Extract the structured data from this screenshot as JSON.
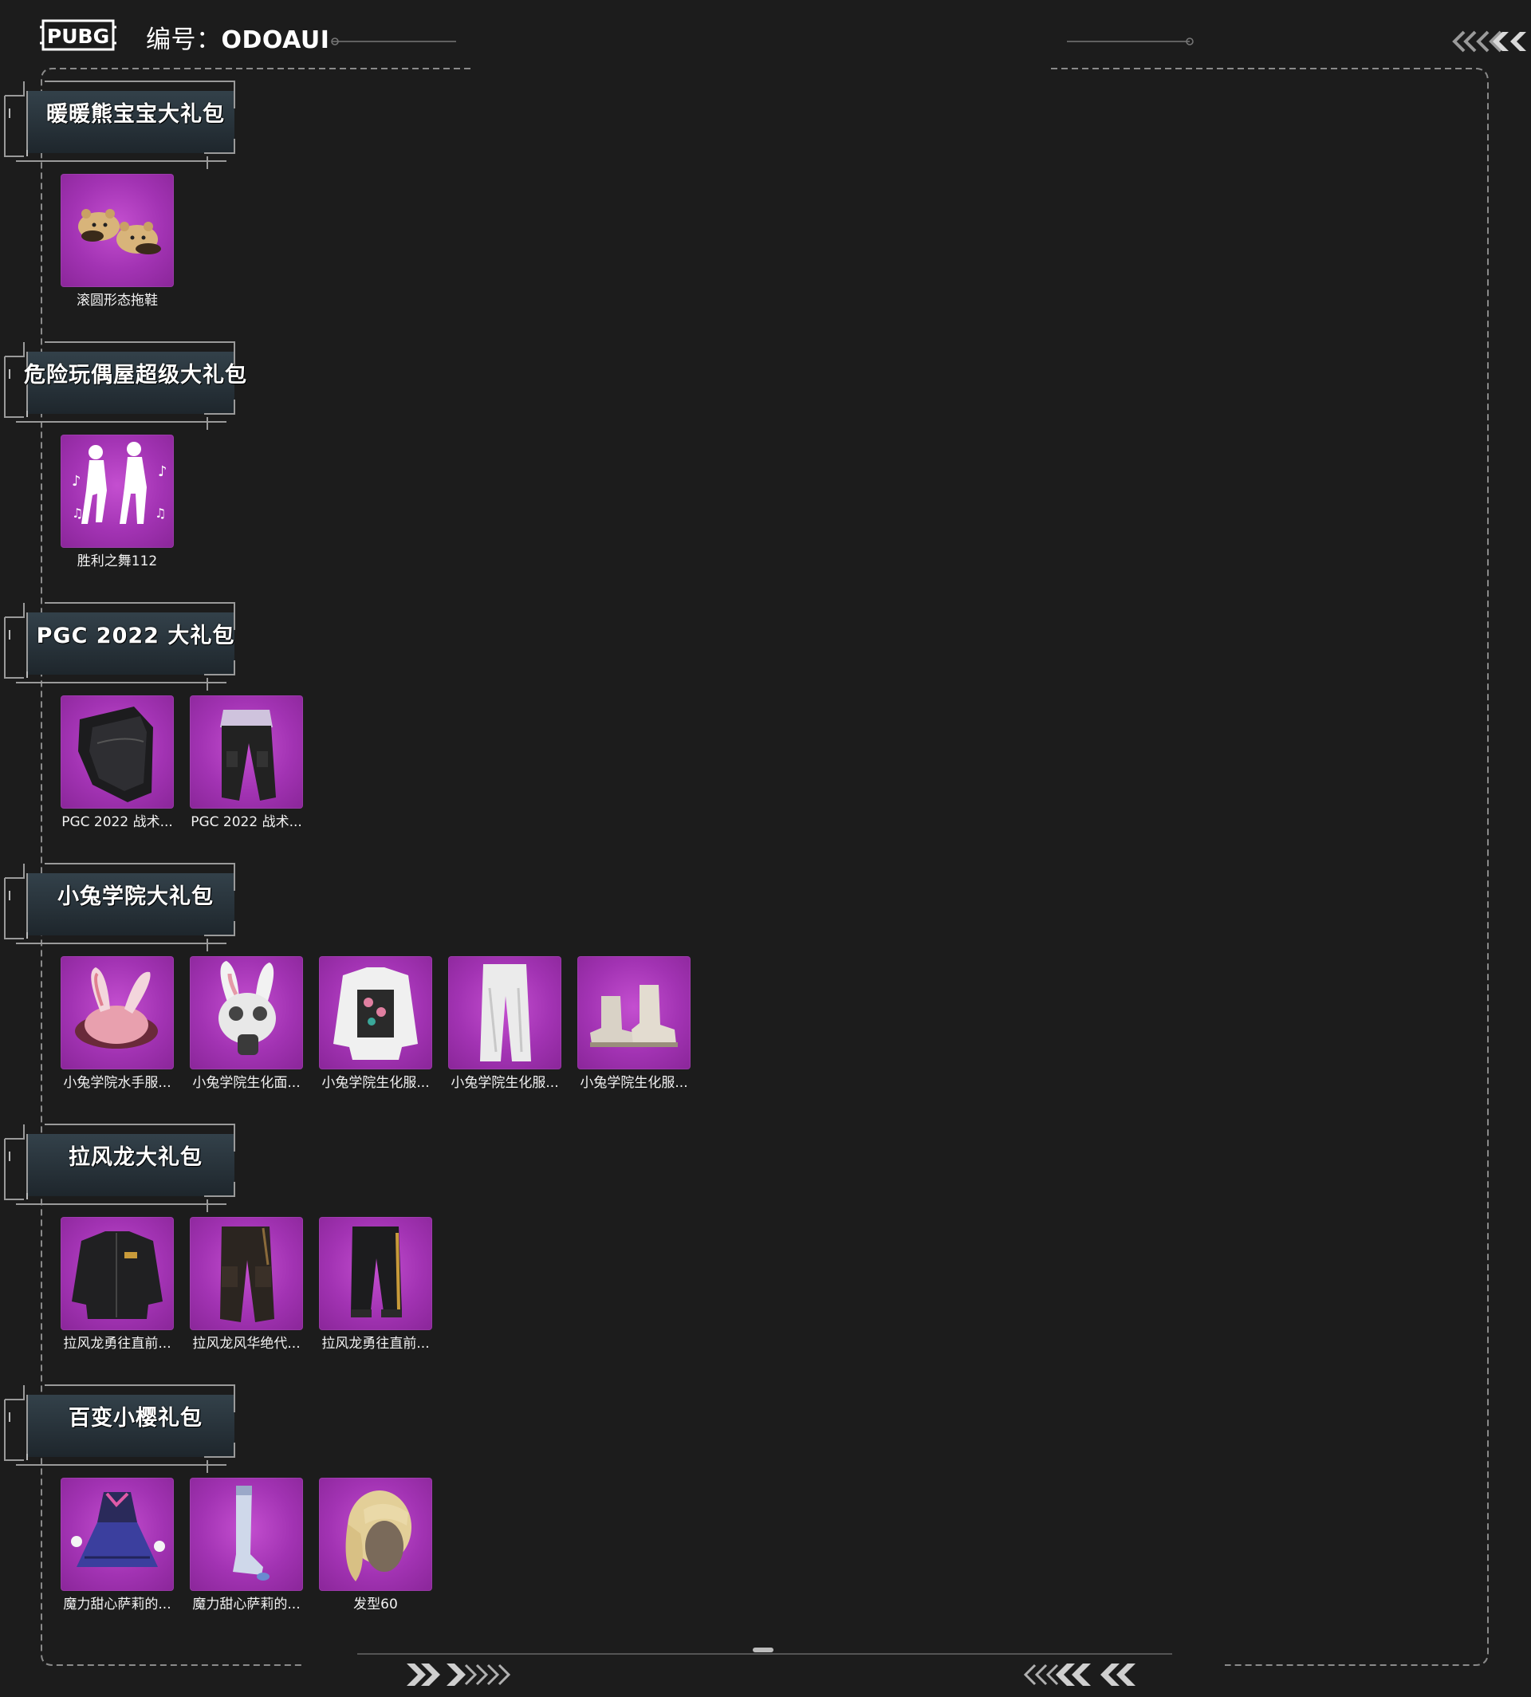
{
  "header": {
    "logo_text": "PUBG",
    "code_prefix": "编号：",
    "code_value": "ODOAUI"
  },
  "colors": {
    "background": "#1c1c1c",
    "item_tile": "#a233b3",
    "frame_line": "#8a8a8a"
  },
  "packs": [
    {
      "title": "暖暖熊宝宝大礼包",
      "items": [
        {
          "name": "滚圆形态拖鞋",
          "icon": "bear-slippers-icon"
        }
      ]
    },
    {
      "title": "危险玩偶屋超级大礼包",
      "items": [
        {
          "name": "胜利之舞112",
          "icon": "dance-emote-icon"
        }
      ]
    },
    {
      "title": "PGC 2022 大礼包",
      "items": [
        {
          "name": "PGC 2022 战术...",
          "icon": "tactical-mask-icon"
        },
        {
          "name": "PGC 2022 战术...",
          "icon": "tactical-pants-icon"
        }
      ]
    },
    {
      "title": "小兔学院大礼包",
      "items": [
        {
          "name": "小兔学院水手服...",
          "icon": "bunny-hat-icon"
        },
        {
          "name": "小兔学院生化面...",
          "icon": "bunny-gasmask-icon"
        },
        {
          "name": "小兔学院生化服...",
          "icon": "bunny-jacket-icon"
        },
        {
          "name": "小兔学院生化服...",
          "icon": "white-pants-icon"
        },
        {
          "name": "小兔学院生化服...",
          "icon": "white-boots-icon"
        }
      ]
    },
    {
      "title": "拉风龙大礼包",
      "items": [
        {
          "name": "拉风龙勇往直前...",
          "icon": "dragon-jacket-icon"
        },
        {
          "name": "拉风龙风华绝代...",
          "icon": "dragon-cargo-pants-icon"
        },
        {
          "name": "拉风龙勇往直前...",
          "icon": "dragon-track-pants-icon"
        }
      ]
    },
    {
      "title": "百变小樱礼包",
      "items": [
        {
          "name": "魔力甜心萨莉的...",
          "icon": "sakura-dress-icon"
        },
        {
          "name": "魔力甜心萨莉的...",
          "icon": "sakura-stockings-icon"
        },
        {
          "name": "发型60",
          "icon": "blonde-hair-icon"
        }
      ]
    }
  ]
}
